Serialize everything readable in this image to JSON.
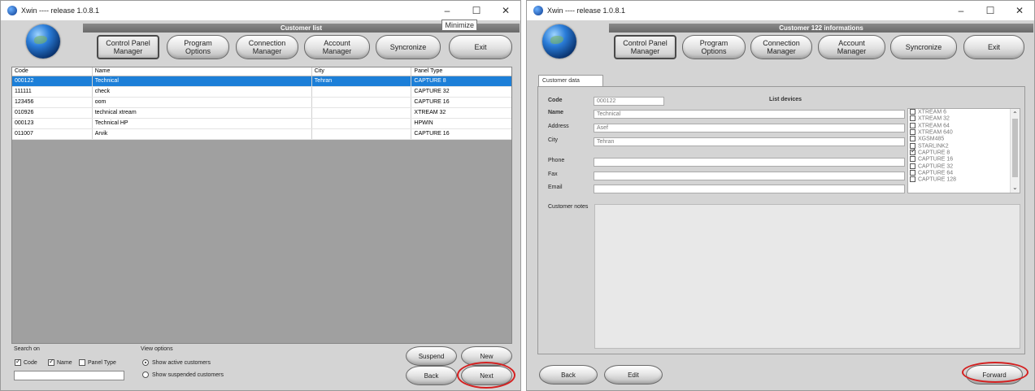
{
  "left_window": {
    "title": "Xwin ---- release 1.0.8.1",
    "tooltip": "Minimize",
    "header_title": "Customer list",
    "nav": [
      "Control Panel Manager",
      "Program Options",
      "Connection Manager",
      "Account Manager",
      "Syncronize",
      "Exit"
    ],
    "columns": [
      "Code",
      "Name",
      "City",
      "Panel Type"
    ],
    "rows": [
      [
        "000122",
        "Technical",
        "Tehran",
        "CAPTURE 8"
      ],
      [
        "111111",
        "check",
        "",
        "CAPTURE 32"
      ],
      [
        "123456",
        "oom",
        "",
        "CAPTURE 16"
      ],
      [
        "010926",
        "technical xtream",
        "",
        "XTREAM 32"
      ],
      [
        "000123",
        "Technical HP",
        "",
        "HPWIN"
      ],
      [
        "011007",
        "Arvik",
        "",
        "CAPTURE 16"
      ]
    ],
    "selected_row": 0,
    "search_label": "Search on",
    "search_checks": [
      {
        "label": "Code",
        "checked": true
      },
      {
        "label": "Name",
        "checked": true
      },
      {
        "label": "Panel Type",
        "checked": false
      }
    ],
    "search_value": "",
    "view_label": "View options",
    "view_options": [
      {
        "label": "Show active customers",
        "checked": true
      },
      {
        "label": "Show suspended customers",
        "checked": false
      }
    ],
    "buttons": {
      "suspend": "Suspend",
      "new": "New",
      "back": "Back",
      "next": "Next"
    }
  },
  "right_window": {
    "title": "Xwin ---- release 1.0.8.1",
    "header_title": "Customer 122 informations",
    "nav": [
      "Control Panel Manager",
      "Program Options",
      "Connection Manager",
      "Account Manager",
      "Syncronize",
      "Exit"
    ],
    "tab": "Customer data",
    "labels": {
      "code": "Code",
      "name": "Name",
      "address": "Address",
      "city": "City",
      "phone": "Phone",
      "fax": "Fax",
      "email": "Email",
      "notes": "Customer notes",
      "devices": "List devices"
    },
    "values": {
      "code": "000122",
      "name": "Technical",
      "address": "Asef",
      "city": "Tehran",
      "phone": "",
      "fax": "",
      "email": ""
    },
    "devices": [
      {
        "label": "XTREAM 6",
        "checked": false
      },
      {
        "label": "XTREAM 32",
        "checked": false
      },
      {
        "label": "XTREAM 64",
        "checked": false
      },
      {
        "label": "XTREAM 640",
        "checked": false
      },
      {
        "label": "XGSM485",
        "checked": false
      },
      {
        "label": "STARLINK2",
        "checked": false
      },
      {
        "label": "CAPTURE 8",
        "checked": true
      },
      {
        "label": "CAPTURE 16",
        "checked": false
      },
      {
        "label": "CAPTURE 32",
        "checked": false
      },
      {
        "label": "CAPTURE 64",
        "checked": false
      },
      {
        "label": "CAPTURE 128",
        "checked": false
      }
    ],
    "buttons": {
      "back": "Back",
      "edit": "Edit",
      "forward": "Forward"
    }
  }
}
